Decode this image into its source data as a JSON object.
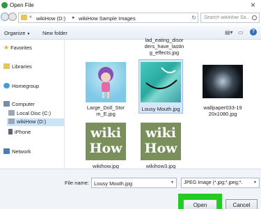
{
  "window": {
    "title": "Open File"
  },
  "address_bar": {
    "crumbs": [
      "wikiHow (D:)",
      "wikiHow Sample Images"
    ],
    "search_placeholder": "Search wikiHow Sa..."
  },
  "toolbar": {
    "organize_label": "Organize",
    "new_folder_label": "New folder"
  },
  "nav": {
    "favorites": "Favorites",
    "libraries": "Libraries",
    "homegroup": "Homegroup",
    "computer": "Computer",
    "local_disc": "Local Disc (C:)",
    "wikihow_drive": "wikiHow (D:)",
    "iphone": "iPhone",
    "network": "Network"
  },
  "files": [
    {
      "name": "lad_eating_disor\nders_have_lastin\ng_effects.jpg",
      "kind": "partial"
    },
    {
      "name": "Large_Doll_Stor\nm_E.jpg",
      "kind": "doll"
    },
    {
      "name": "Lousy Mouth.jpg",
      "kind": "mouth",
      "selected": true
    },
    {
      "name": "wallpaper033-19\n20x1080.jpg",
      "kind": "wallpaper"
    },
    {
      "name": "wikihow.jpg",
      "kind": "wiki",
      "art_line1": "wiki",
      "art_line2": "How"
    },
    {
      "name": "wikihow3.jpg",
      "kind": "wiki",
      "art_line1": "wiki",
      "art_line2": "How"
    }
  ],
  "bottom": {
    "file_name_label": "File name:",
    "file_name_value": "Lousy Mouth.jpg",
    "file_type_value": "JPEG Image (*.jpg;*.jpeg;*.",
    "open_label": "Open",
    "cancel_label": "Cancel"
  },
  "colors": {
    "highlight": "#22cc22",
    "selection": "#d6e8f8"
  }
}
